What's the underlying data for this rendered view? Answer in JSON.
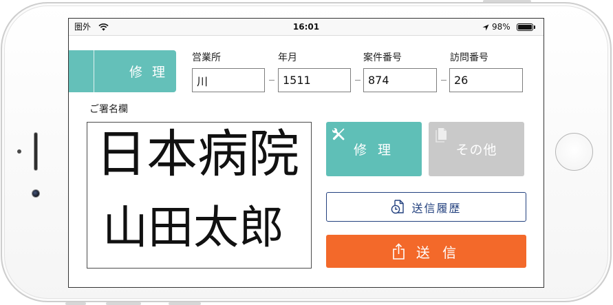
{
  "status_bar": {
    "carrier": "圏外",
    "time": "16:01",
    "battery_percent": "98%",
    "battery_level": 0.98,
    "icons": {
      "wifi": "wifi-icon",
      "location": "location-arrow-icon",
      "battery": "battery-icon"
    }
  },
  "header": {
    "category_label": "修 理",
    "color": "#64c0b9"
  },
  "form": {
    "fields": [
      {
        "label": "営業所",
        "value": "川"
      },
      {
        "label": "年月",
        "value": "1511"
      },
      {
        "label": "案件番号",
        "value": "874"
      },
      {
        "label": "訪問番号",
        "value": "26"
      }
    ]
  },
  "signature": {
    "label": "ご署名欄",
    "handwriting": [
      "日本病院",
      "山田太郎"
    ]
  },
  "actions": {
    "repair": {
      "label": "修 理",
      "icon": "tools-icon",
      "color": "#5fbfb7"
    },
    "other": {
      "label": "その他",
      "icon": "document-icon",
      "color": "#c9c9c9"
    },
    "history": {
      "label": "送信履歴",
      "icon": "history-document-icon",
      "color": "#22407e"
    },
    "send": {
      "label": "送 信",
      "icon": "share-icon",
      "color": "#f3692a"
    }
  }
}
